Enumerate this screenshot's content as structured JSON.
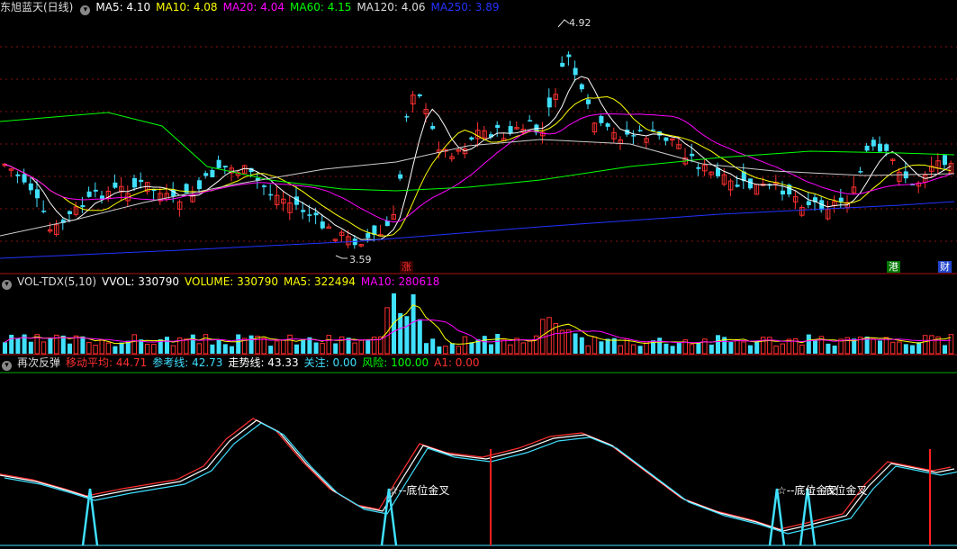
{
  "main": {
    "title": "东旭蓝天(日线)",
    "indicators": [
      {
        "label": "MA5: 4.10",
        "color": "#ffffff"
      },
      {
        "label": "MA10: 4.08",
        "color": "#ffff00"
      },
      {
        "label": "MA20: 4.04",
        "color": "#ff00ff"
      },
      {
        "label": "MA60: 4.15",
        "color": "#00ff00"
      },
      {
        "label": "MA120: 4.06",
        "color": "#dddddd"
      },
      {
        "label": "MA250: 3.89",
        "color": "#2233ff"
      }
    ],
    "high_label": "4.92",
    "low_label": "3.59",
    "badges": [
      {
        "text": "涨",
        "color": "#ff3030",
        "bg": "#330000"
      },
      {
        "text": "港",
        "color": "#ffffff",
        "bg": "#007700"
      },
      {
        "text": "财",
        "color": "#ffffff",
        "bg": "#2244cc"
      }
    ]
  },
  "volume": {
    "indicators": [
      {
        "label": "VOL-TDX(5,10)",
        "color": "#dddddd"
      },
      {
        "label": "VVOL: 330790",
        "color": "#ffffff"
      },
      {
        "label": "VOLUME: 330790",
        "color": "#ffff00"
      },
      {
        "label": "MA5: 322494",
        "color": "#ffff00"
      },
      {
        "label": "MA10: 280618",
        "color": "#ff00ff"
      }
    ]
  },
  "signal": {
    "indicators": [
      {
        "label": "再次反弹",
        "color": "#dddddd"
      },
      {
        "label": "移动平均: 44.71",
        "color": "#ff3030"
      },
      {
        "label": "参考线: 42.73",
        "color": "#40e0ff"
      },
      {
        "label": "走势线: 43.33",
        "color": "#ffffff"
      },
      {
        "label": "关注: 0.00",
        "color": "#40e0ff"
      },
      {
        "label": "风险: 100.00",
        "color": "#00ff00"
      },
      {
        "label": "A1: 0.00",
        "color": "#ff3030"
      }
    ],
    "annotations": [
      "☆--底位金叉",
      "☆--底位金叉",
      "☆--底位金叉"
    ]
  },
  "colors": {
    "up": "#ff3030",
    "down": "#40e0ff",
    "grid": "#8a1010"
  }
}
